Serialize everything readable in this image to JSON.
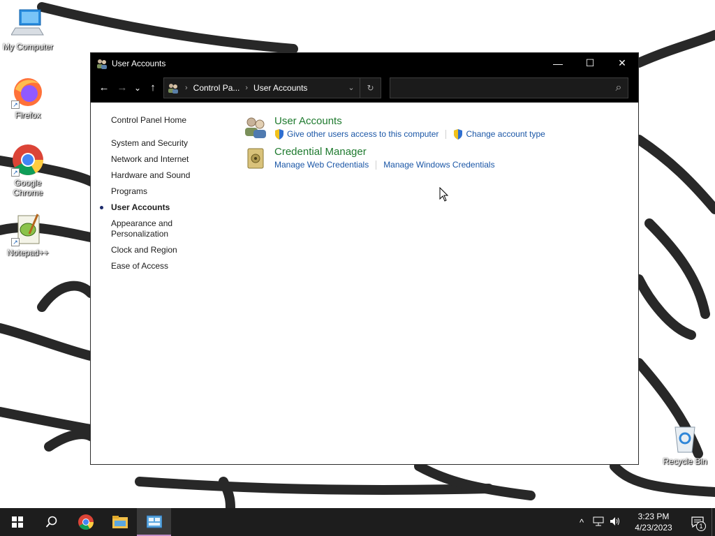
{
  "desktop": {
    "icons": [
      {
        "label": "My Computer",
        "icon": "computer-icon"
      },
      {
        "label": "Firefox",
        "icon": "firefox-icon"
      },
      {
        "label": "Google Chrome",
        "icon": "chrome-icon"
      },
      {
        "label": "Notepad++",
        "icon": "notepadpp-icon"
      }
    ],
    "recycle_bin": {
      "label": "Recycle Bin",
      "icon": "recycle-bin-icon"
    }
  },
  "window": {
    "title": "User Accounts",
    "controls": {
      "minimize": "—",
      "maximize": "☐",
      "close": "✕"
    },
    "nav": {
      "back": "←",
      "forward": "→",
      "recent": "⌄",
      "up": "↑"
    },
    "address": {
      "crumbs": [
        "Control Pa...",
        "User Accounts"
      ],
      "separator": "›"
    },
    "search": {
      "placeholder": "",
      "value": ""
    },
    "sidebar": {
      "home": "Control Panel Home",
      "items": [
        {
          "label": "System and Security",
          "current": false
        },
        {
          "label": "Network and Internet",
          "current": false
        },
        {
          "label": "Hardware and Sound",
          "current": false
        },
        {
          "label": "Programs",
          "current": false
        },
        {
          "label": "User Accounts",
          "current": true
        },
        {
          "label": "Appearance and Personalization",
          "current": false
        },
        {
          "label": "Clock and Region",
          "current": false
        },
        {
          "label": "Ease of Access",
          "current": false
        }
      ]
    },
    "categories": [
      {
        "title": "User Accounts",
        "icon": "user-accounts-icon",
        "links": [
          {
            "label": "Give other users access to this computer",
            "shield": true
          },
          {
            "label": "Change account type",
            "shield": true
          }
        ]
      },
      {
        "title": "Credential Manager",
        "icon": "credential-manager-icon",
        "links": [
          {
            "label": "Manage Web Credentials",
            "shield": false
          },
          {
            "label": "Manage Windows Credentials",
            "shield": false
          }
        ]
      }
    ]
  },
  "taskbar": {
    "buttons": [
      "start-icon",
      "search-icon",
      "chrome-icon",
      "file-explorer-icon",
      "control-panel-icon"
    ],
    "active": "control-panel-icon",
    "tray": {
      "chevron": "^",
      "time": "3:23 PM",
      "date": "4/23/2023",
      "notifications": "1"
    }
  },
  "colors": {
    "title_bar": "#000000",
    "category_title": "#1e7a2e",
    "link": "#1a56a6",
    "taskbar": "#1d1d1d"
  }
}
